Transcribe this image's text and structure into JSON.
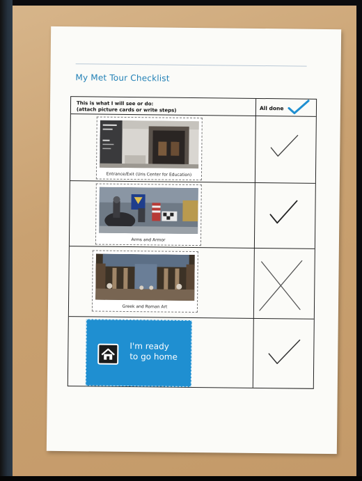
{
  "sheet": {
    "title": "My Met Tour Checklist",
    "header": {
      "line1": "This is what I will see or do:",
      "line2": "(attach picture cards or write steps)",
      "done_label": "All done"
    },
    "rows": [
      {
        "caption": "Entrance/Exit (Uris Center for Education)",
        "mark": "check"
      },
      {
        "caption": "Arms and Armor",
        "mark": "check"
      },
      {
        "caption": "Greek and Roman Art",
        "mark": "cross"
      },
      {
        "caption_line1": "I'm ready",
        "caption_line2": "to go home",
        "mark": "check"
      }
    ]
  },
  "colors": {
    "title_blue": "#1f7fb5",
    "home_card_blue": "#1f8fd1",
    "table_wood": "#c9a171"
  },
  "icons": [
    "checkmark-icon",
    "cross-icon",
    "home-icon"
  ]
}
